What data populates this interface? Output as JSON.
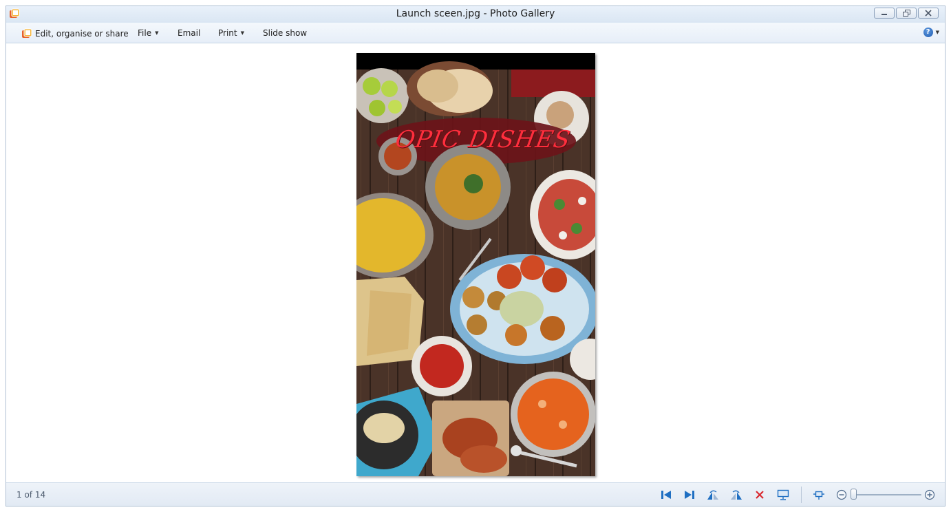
{
  "window": {
    "title": "Launch sceen.jpg - Photo Gallery"
  },
  "menubar": {
    "items": [
      {
        "label": "Edit, organise or share",
        "icon": "photo-gallery-icon",
        "has_caret": false
      },
      {
        "label": "File",
        "has_caret": true
      },
      {
        "label": "Email",
        "has_caret": false
      },
      {
        "label": "Print",
        "has_caret": true
      },
      {
        "label": "Slide show",
        "has_caret": false
      }
    ],
    "help_icon": "help-icon"
  },
  "photo": {
    "overlay_text": "OPIC DISHES",
    "text_color": "#ff2e3d"
  },
  "statusbar": {
    "counter": "1 of 14",
    "tools": [
      "previous-icon",
      "next-icon",
      "rotate-left-icon",
      "rotate-right-icon",
      "delete-icon",
      "slideshow-icon",
      "actual-size-icon",
      "zoom-out-icon",
      "zoom-in-icon"
    ],
    "zoom_level": 0.05
  },
  "colors": {
    "accent": "#1f6fc2",
    "delete": "#d9282f"
  }
}
